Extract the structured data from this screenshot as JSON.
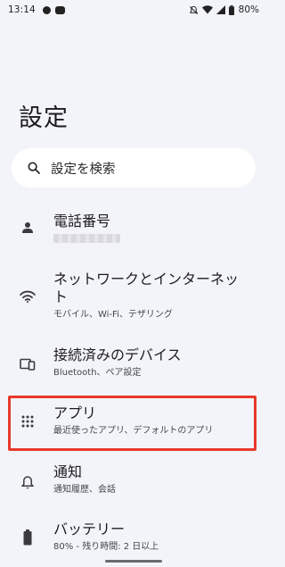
{
  "status_bar": {
    "time": "13:14",
    "notifications": [
      "facebook-icon",
      "line-icon"
    ],
    "indicators": [
      "mute-icon",
      "wifi-icon",
      "signal-icon",
      "battery-icon"
    ],
    "battery": "80%"
  },
  "page": {
    "title": "設定"
  },
  "search": {
    "placeholder": "設定を検索"
  },
  "items": [
    {
      "title": "電話番号",
      "subtitle": "",
      "icon": "person-icon",
      "redacted": true
    },
    {
      "title_line1": "ネットワークとインターネッ",
      "title_line2": "ト",
      "subtitle": "モバイル、Wi-Fi、テザリング",
      "icon": "wifi-icon"
    },
    {
      "title": "接続済みのデバイス",
      "subtitle": "Bluetooth、ペア設定",
      "icon": "devices-icon"
    },
    {
      "title": "アプリ",
      "subtitle": "最近使ったアプリ、デフォルトのアプリ",
      "icon": "apps-grid-icon",
      "highlighted": true
    },
    {
      "title": "通知",
      "subtitle": "通知履歴、会話",
      "icon": "bell-icon"
    },
    {
      "title": "バッテリー",
      "subtitle": "80% - 残り時間: 2 日以上",
      "icon": "battery-icon"
    }
  ],
  "colors": {
    "background": "#f3f4f9",
    "surface": "#ffffff",
    "highlight": "#e8392b"
  }
}
